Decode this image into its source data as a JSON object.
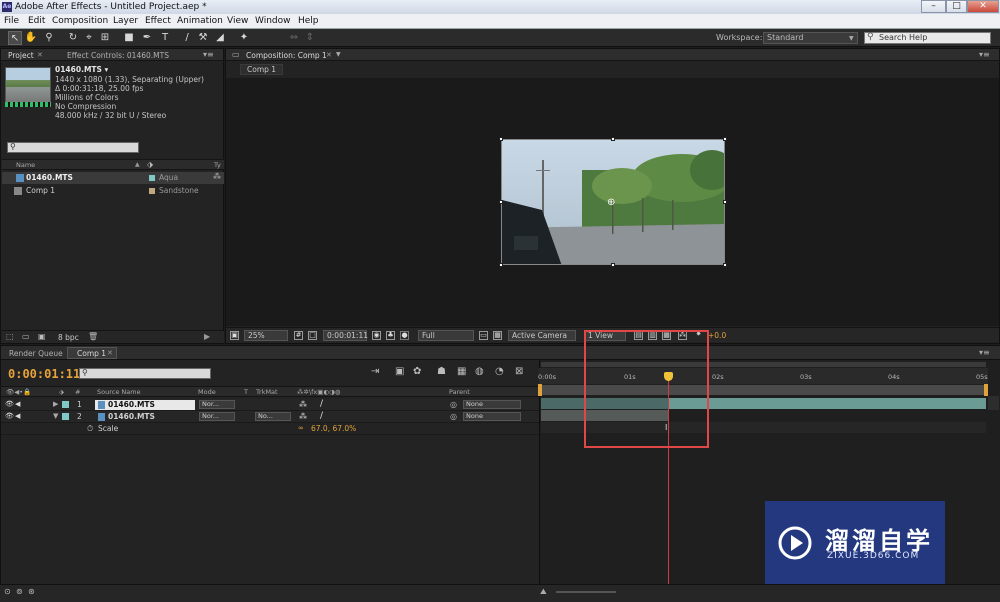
{
  "app": {
    "title": "Adobe After Effects - Untitled Project.aep *",
    "logo": "Ae"
  },
  "window_controls": {
    "minimize": "–",
    "maximize": "□",
    "close": "✕"
  },
  "menu": [
    "File",
    "Edit",
    "Composition",
    "Layer",
    "Effect",
    "Animation",
    "View",
    "Window",
    "Help"
  ],
  "toolbar": {
    "workspace_label": "Workspace:",
    "workspace_value": "Standard",
    "search_placeholder": "Search Help"
  },
  "project_panel": {
    "tabs": [
      "Project",
      "Effect Controls: 01460.MTS"
    ],
    "selected_item": {
      "name": "01460.MTS ▾",
      "line1": "1440 x 1080 (1.33), Separating (Upper)",
      "line2": "Δ 0:00:31:18, 25.00 fps",
      "line3": "Millions of Colors",
      "line4": "No Compression",
      "line5": "48.000 kHz / 32 bit U / Stereo"
    },
    "columns": {
      "name": "Name",
      "type": "Ty"
    },
    "items": [
      {
        "name": "01460.MTS",
        "label": "Aqua",
        "label_color": "#7fc8c6"
      },
      {
        "name": "Comp 1",
        "label": "Sandstone",
        "label_color": "#c2a77e"
      }
    ],
    "bpc": "8 bpc"
  },
  "comp_panel": {
    "tab": "Composition: Comp 1",
    "subtab": "Comp 1",
    "footer": {
      "zoom": "25%",
      "timecode": "0:00:01:11",
      "resolution": "Full",
      "camera": "Active Camera",
      "views": "1 View",
      "exposure": "+0.0"
    }
  },
  "timeline": {
    "tabs": [
      "Render Queue",
      "Comp 1"
    ],
    "timecode": "0:00:01:11",
    "columns": {
      "num": "#",
      "source": "Source Name",
      "mode": "Mode",
      "t": "T",
      "trkmat": "TrkMat",
      "parent": "Parent"
    },
    "layers": [
      {
        "num": "1",
        "name": "01460.MTS",
        "mode": "Nor...",
        "trkmat": "",
        "parent": "None",
        "color": "#7fc8c6"
      },
      {
        "num": "2",
        "name": "01460.MTS",
        "mode": "Nor...",
        "trkmat": "No...",
        "parent": "None",
        "color": "#7fc8c6"
      }
    ],
    "property": {
      "name": "Scale",
      "value": "67.0, 67.0%"
    },
    "ruler_labels": [
      "0:00s",
      "01s",
      "02s",
      "03s",
      "04s",
      "05s"
    ]
  },
  "watermark": {
    "title": "溜溜自学",
    "subtitle": "ZIXUE.3D66.COM"
  }
}
